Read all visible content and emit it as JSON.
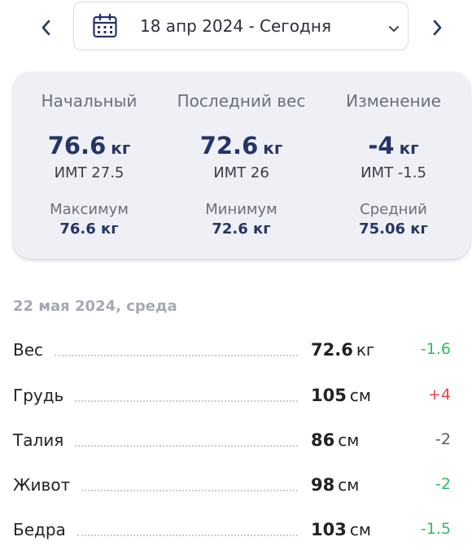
{
  "date_nav": {
    "label": "18 апр 2024 - Сегодня"
  },
  "summary": {
    "initial": {
      "heading": "Начальный",
      "value": "76.6",
      "unit": "кг",
      "bmi": "ИМТ 27.5",
      "sub_label": "Максимум",
      "sub_value": "76.6 кг"
    },
    "last": {
      "heading": "Последний вес",
      "value": "72.6",
      "unit": "кг",
      "bmi": "ИМТ 26",
      "sub_label": "Минимум",
      "sub_value": "72.6 кг"
    },
    "change": {
      "heading": "Изменение",
      "value": "-4",
      "unit": "кг",
      "bmi": "ИМТ -1.5",
      "sub_label": "Средний",
      "sub_value": "75.06 кг"
    }
  },
  "entry": {
    "date": "22 мая 2024, среда",
    "rows": [
      {
        "name": "Вес",
        "value": "72.6",
        "unit": "кг",
        "delta": "-1.6",
        "delta_color": "#2ebd5f"
      },
      {
        "name": "Грудь",
        "value": "105",
        "unit": "см",
        "delta": "+4",
        "delta_color": "#e04848"
      },
      {
        "name": "Талия",
        "value": "86",
        "unit": "см",
        "delta": "-2",
        "delta_color": "#555a66"
      },
      {
        "name": "Живот",
        "value": "98",
        "unit": "см",
        "delta": "-2",
        "delta_color": "#2ebd5f"
      },
      {
        "name": "Бедра",
        "value": "103",
        "unit": "см",
        "delta": "-1.5",
        "delta_color": "#2ebd5f"
      }
    ]
  },
  "icons": {
    "prev": "chevron-left-icon",
    "next": "chevron-right-icon",
    "calendar": "calendar-icon",
    "dropdown": "chevron-down-icon"
  },
  "colors": {
    "accent": "#263466",
    "positive": "#2ebd5f",
    "negative": "#e04848"
  }
}
